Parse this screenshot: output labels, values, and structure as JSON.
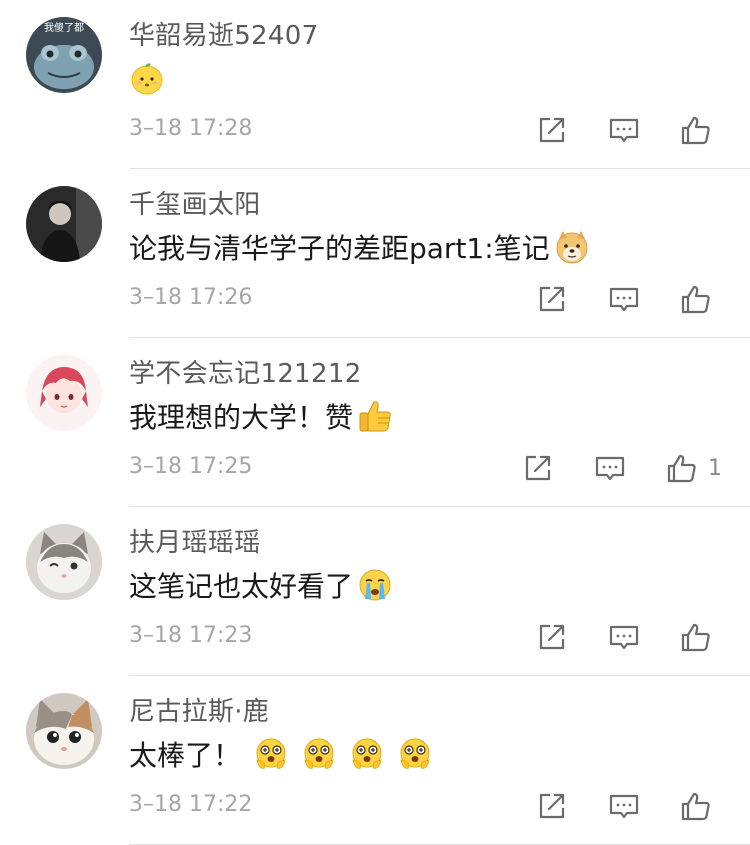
{
  "comments": [
    {
      "username": "华韶易逝52407",
      "text": "",
      "avatar_badge": "我傻了都",
      "emojis": [
        "lemon-face"
      ],
      "timestamp": "3–18 17:28",
      "like_count": ""
    },
    {
      "username": "千玺画太阳",
      "text": "论我与清华学子的差距part1:笔记",
      "emojis": [
        "doge-face"
      ],
      "timestamp": "3–18 17:26",
      "like_count": ""
    },
    {
      "username": "学不会忘记121212",
      "text": "我理想的大学！赞",
      "emojis": [
        "thumbs-up"
      ],
      "timestamp": "3–18 17:25",
      "like_count": "1"
    },
    {
      "username": "扶月瑶瑶瑶",
      "text": "这笔记也太好看了",
      "emojis": [
        "crying-face"
      ],
      "timestamp": "3–18 17:23",
      "like_count": ""
    },
    {
      "username": "尼古拉斯·鹿",
      "text": "太棒了！",
      "emojis": [
        "amazed-face",
        "amazed-face",
        "amazed-face",
        "amazed-face"
      ],
      "timestamp": "3–18 17:22",
      "like_count": ""
    }
  ],
  "icons": {
    "share": "share-icon",
    "reply": "reply-icon",
    "like": "like-icon"
  },
  "colors": {
    "username": "#5a5a5a",
    "text": "#1a1a1a",
    "timestamp": "#a6a6a6",
    "icon": "#6b6b6b",
    "divider": "#e3e3e3"
  }
}
